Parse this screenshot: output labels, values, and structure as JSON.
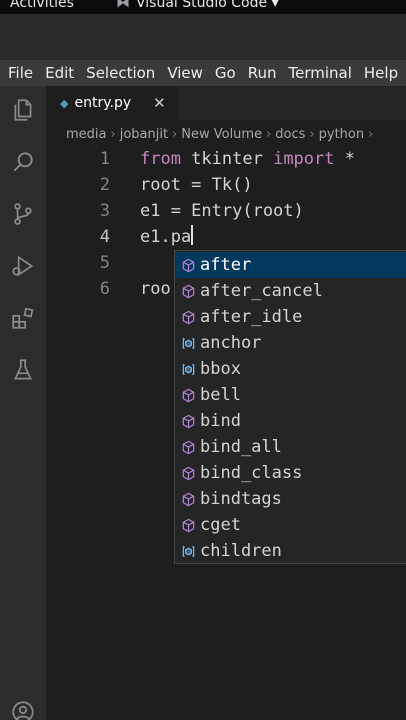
{
  "os_bar": {
    "activities": "Activities",
    "app_name": "Visual Studio Code ▾"
  },
  "menu": [
    "File",
    "Edit",
    "Selection",
    "View",
    "Go",
    "Run",
    "Terminal",
    "Help"
  ],
  "tab": {
    "file_name": "entry.py",
    "close": "✕"
  },
  "breadcrumb": [
    "media",
    "jobanjit",
    "New Volume",
    "docs",
    "python"
  ],
  "editor": {
    "lines": [
      {
        "number": "1",
        "parts": [
          {
            "text": "from",
            "type": "keyword"
          },
          {
            "text": " tkinter ",
            "type": "plain"
          },
          {
            "text": "import",
            "type": "keyword"
          },
          {
            "text": " *",
            "type": "plain"
          }
        ]
      },
      {
        "number": "2",
        "parts": [
          {
            "text": "root = Tk()",
            "type": "plain"
          }
        ]
      },
      {
        "number": "3",
        "parts": [
          {
            "text": "e1 = Entry(root)",
            "type": "plain"
          }
        ]
      },
      {
        "number": "4",
        "parts": [
          {
            "text": "e1.pa",
            "type": "plain"
          }
        ]
      },
      {
        "number": "5",
        "parts": []
      },
      {
        "number": "6",
        "parts": [
          {
            "text": "roo",
            "type": "plain"
          }
        ]
      }
    ],
    "active_line": "4"
  },
  "suggestions": [
    {
      "label": "after",
      "kind": "method",
      "selected": true
    },
    {
      "label": "after_cancel",
      "kind": "method",
      "selected": false
    },
    {
      "label": "after_idle",
      "kind": "method",
      "selected": false
    },
    {
      "label": "anchor",
      "kind": "field",
      "selected": false
    },
    {
      "label": "bbox",
      "kind": "field",
      "selected": false
    },
    {
      "label": "bell",
      "kind": "method",
      "selected": false
    },
    {
      "label": "bind",
      "kind": "method",
      "selected": false
    },
    {
      "label": "bind_all",
      "kind": "method",
      "selected": false
    },
    {
      "label": "bind_class",
      "kind": "method",
      "selected": false
    },
    {
      "label": "bindtags",
      "kind": "method",
      "selected": false
    },
    {
      "label": "cget",
      "kind": "method",
      "selected": false
    },
    {
      "label": "children",
      "kind": "field",
      "selected": false
    }
  ],
  "colors": {
    "keyword": "#c586c0",
    "method_icon": "#b180d7",
    "field_icon": "#75beff",
    "selection": "#04395e",
    "python_icon": "#519aba"
  },
  "activity_icons": [
    "explorer-icon",
    "search-icon",
    "source-control-icon",
    "run-debug-icon",
    "extensions-icon",
    "testing-icon",
    "account-icon"
  ]
}
